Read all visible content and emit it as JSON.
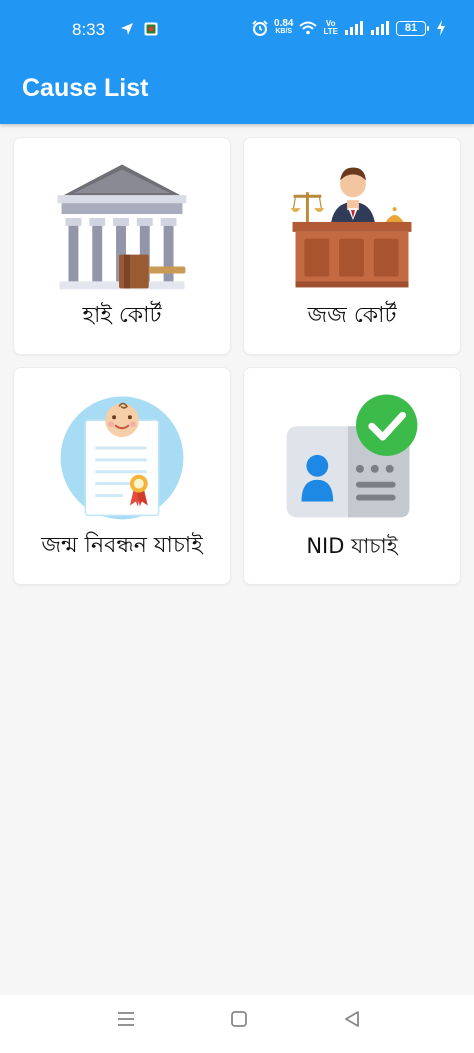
{
  "status_bar": {
    "time": "8:33",
    "net_speed_value": "0.84",
    "net_speed_unit": "KB/S",
    "volte_top": "Vo",
    "volte_bottom": "LTE",
    "battery": "81",
    "icons": [
      "navigation-arrow-icon",
      "app-notification-icon",
      "alarm-icon",
      "wifi-icon",
      "signal-icon",
      "signal-icon",
      "charging-icon"
    ]
  },
  "app_bar": {
    "title": "Cause List",
    "color": "#2196f3"
  },
  "cards": [
    {
      "id": "high-court",
      "label": "হাই কোর্ট",
      "icon": "high-court-building-icon"
    },
    {
      "id": "judge-court",
      "label": "জজ কোর্ট",
      "icon": "judge-at-bench-icon"
    },
    {
      "id": "birth-registration",
      "label": "জন্ম নিবন্ধন যাচাই",
      "icon": "birth-certificate-icon"
    },
    {
      "id": "nid",
      "label": "NID যাচাই",
      "icon": "id-card-verified-icon"
    }
  ],
  "nav_bar": {
    "buttons": [
      "menu-icon",
      "home-square-icon",
      "back-triangle-icon"
    ]
  }
}
